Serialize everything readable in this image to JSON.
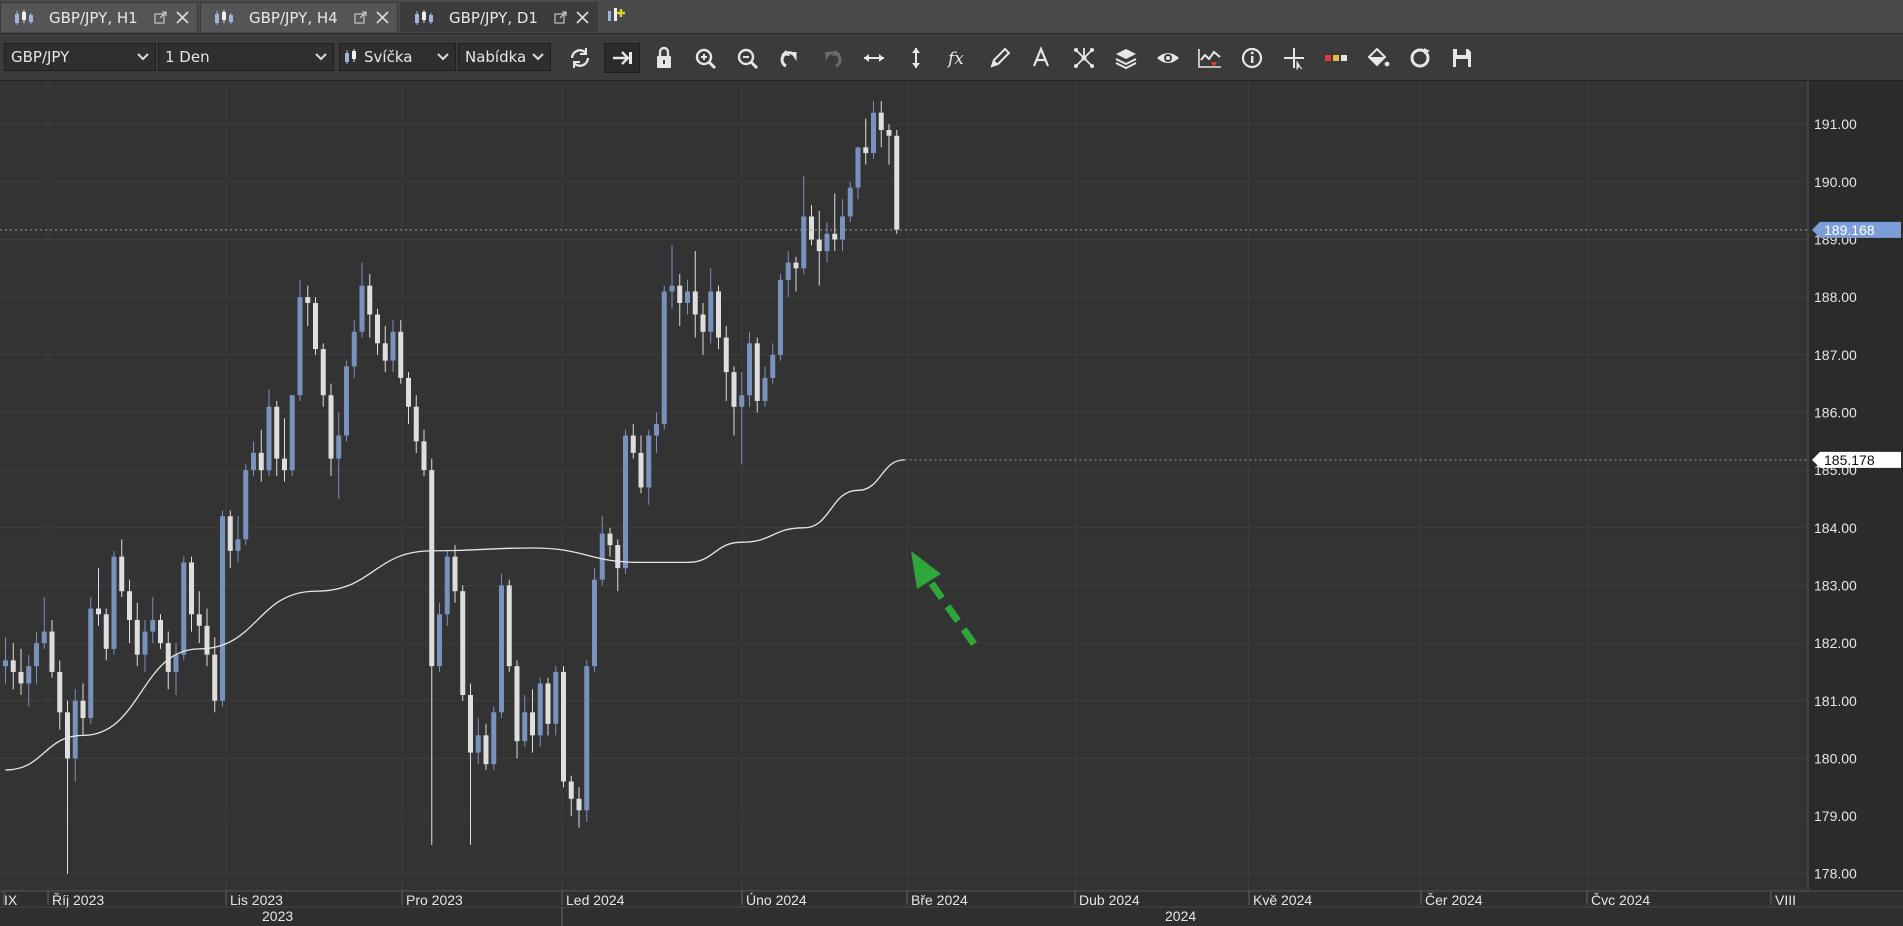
{
  "tabs": [
    {
      "label": "GBP/JPY, H1",
      "active": false
    },
    {
      "label": "GBP/JPY, H4",
      "active": false
    },
    {
      "label": "GBP/JPY, D1",
      "active": true
    }
  ],
  "toolbar": {
    "instrument": "GBP/JPY",
    "period": "1 Den",
    "chart_type": "Svíčka",
    "offer_side": "Nabídka",
    "buttons": [
      "refresh-icon",
      "shift-chart-icon",
      "lock-icon",
      "zoom-in-icon",
      "zoom-out-icon",
      "undo-icon",
      "redo-icon",
      "horizontal-scale-icon",
      "vertical-scale-icon",
      "indicators-fx-icon",
      "pencil-icon",
      "text-icon",
      "pattern-icon",
      "layers-icon",
      "eye-icon",
      "signals-icon",
      "info-icon",
      "crosshair-icon",
      "price-marker-icon",
      "paint-bucket-icon",
      "reload-template-icon",
      "save-icon"
    ],
    "pressed": [
      "shift-chart-icon"
    ]
  },
  "colors": {
    "bull": "#7891bd",
    "bear": "#dedede",
    "ma_line": "#e6e6e6",
    "last_price_badge": "#7c9ed6",
    "ma_badge": "#ffffff",
    "arrow": "#2fa63a",
    "background": "#333333",
    "grid": "#3e3e3e"
  },
  "chart_data": {
    "type": "candlestick",
    "symbol": "GBP/JPY",
    "timeframe": "D1",
    "y_ticks": [
      "191.00",
      "190.00",
      "189.00",
      "188.00",
      "187.00",
      "186.00",
      "185.00",
      "184.00",
      "183.00",
      "182.00",
      "181.00",
      "180.00",
      "179.00",
      "178.00"
    ],
    "ylim": [
      177.7,
      191.75
    ],
    "last_price": "189.168",
    "ma_last": "185.178",
    "x_labels": [
      "IX",
      "Říj 2023",
      "Lis 2023",
      "Pro 2023",
      "Led 2024",
      "Úno 2024",
      "Bře 2024",
      "Dub 2024",
      "Kvě 2024",
      "Čer 2024",
      "Čvc 2024",
      "VIII"
    ],
    "year_labels": [
      "2023",
      "2024"
    ],
    "ohlc": [
      [
        181.6,
        182.1,
        181.3,
        181.7
      ],
      [
        181.7,
        182.0,
        181.2,
        181.5
      ],
      [
        181.5,
        181.9,
        181.1,
        181.3
      ],
      [
        181.3,
        181.8,
        180.9,
        181.6
      ],
      [
        181.6,
        182.2,
        181.3,
        182.0
      ],
      [
        182.0,
        182.8,
        181.9,
        182.2
      ],
      [
        182.2,
        182.4,
        181.4,
        181.5
      ],
      [
        181.5,
        181.7,
        180.5,
        180.8
      ],
      [
        180.8,
        181.0,
        178.0,
        180.0
      ],
      [
        180.0,
        181.2,
        179.6,
        181.0
      ],
      [
        181.0,
        181.3,
        180.4,
        180.7
      ],
      [
        180.7,
        182.8,
        180.6,
        182.6
      ],
      [
        182.6,
        183.3,
        182.3,
        182.5
      ],
      [
        182.5,
        182.6,
        181.7,
        181.9
      ],
      [
        181.9,
        183.6,
        181.8,
        183.5
      ],
      [
        183.5,
        183.8,
        182.8,
        182.9
      ],
      [
        182.9,
        183.1,
        182.0,
        182.4
      ],
      [
        182.4,
        182.7,
        181.6,
        181.8
      ],
      [
        181.8,
        182.4,
        181.5,
        182.2
      ],
      [
        182.2,
        182.8,
        182.0,
        182.4
      ],
      [
        182.4,
        182.5,
        181.9,
        182.0
      ],
      [
        182.0,
        182.2,
        181.2,
        181.5
      ],
      [
        181.5,
        182.0,
        181.1,
        181.8
      ],
      [
        181.8,
        183.5,
        181.7,
        183.4
      ],
      [
        183.4,
        183.5,
        182.2,
        182.5
      ],
      [
        182.5,
        182.9,
        182.0,
        182.3
      ],
      [
        182.3,
        182.6,
        181.6,
        181.8
      ],
      [
        181.8,
        182.1,
        180.8,
        181.0
      ],
      [
        181.0,
        184.3,
        180.9,
        184.2
      ],
      [
        184.2,
        184.3,
        183.3,
        183.6
      ],
      [
        183.6,
        184.2,
        183.4,
        183.8
      ],
      [
        183.8,
        185.1,
        183.7,
        185.0
      ],
      [
        185.0,
        185.5,
        184.9,
        185.3
      ],
      [
        185.3,
        185.7,
        184.8,
        185.0
      ],
      [
        185.0,
        186.4,
        184.9,
        186.1
      ],
      [
        186.1,
        186.2,
        184.9,
        185.2
      ],
      [
        185.2,
        185.9,
        184.8,
        185.0
      ],
      [
        185.0,
        186.3,
        184.9,
        186.3
      ],
      [
        186.3,
        188.3,
        186.2,
        188.0
      ],
      [
        188.0,
        188.2,
        187.5,
        187.9
      ],
      [
        187.9,
        188.0,
        187.0,
        187.1
      ],
      [
        187.1,
        187.2,
        186.1,
        186.3
      ],
      [
        186.3,
        186.5,
        184.9,
        185.2
      ],
      [
        185.2,
        186.0,
        184.5,
        185.6
      ],
      [
        185.6,
        186.9,
        185.5,
        186.8
      ],
      [
        186.8,
        187.6,
        186.6,
        187.4
      ],
      [
        187.4,
        188.6,
        187.3,
        188.2
      ],
      [
        188.2,
        188.4,
        187.3,
        187.7
      ],
      [
        187.7,
        187.8,
        187.0,
        187.2
      ],
      [
        187.2,
        187.5,
        186.7,
        186.9
      ],
      [
        186.9,
        187.6,
        186.7,
        187.4
      ],
      [
        187.4,
        187.6,
        186.5,
        186.6
      ],
      [
        186.6,
        186.7,
        185.8,
        186.1
      ],
      [
        186.1,
        186.3,
        185.3,
        185.5
      ],
      [
        185.5,
        185.7,
        184.9,
        185.0
      ],
      [
        185.0,
        185.2,
        178.5,
        181.6
      ],
      [
        181.6,
        182.7,
        181.5,
        182.5
      ],
      [
        182.5,
        183.6,
        182.3,
        183.5
      ],
      [
        183.5,
        183.7,
        182.7,
        182.9
      ],
      [
        182.9,
        183.0,
        181.0,
        181.1
      ],
      [
        181.1,
        181.3,
        178.5,
        180.1
      ],
      [
        180.1,
        180.7,
        179.9,
        180.4
      ],
      [
        180.4,
        180.6,
        179.8,
        179.9
      ],
      [
        179.9,
        180.9,
        179.8,
        180.8
      ],
      [
        180.8,
        183.2,
        180.7,
        183.0
      ],
      [
        183.0,
        183.1,
        181.5,
        181.6
      ],
      [
        181.6,
        181.7,
        180.0,
        180.3
      ],
      [
        180.3,
        181.1,
        180.2,
        180.8
      ],
      [
        180.8,
        181.2,
        180.1,
        180.4
      ],
      [
        180.4,
        181.4,
        180.2,
        181.3
      ],
      [
        181.3,
        181.4,
        180.4,
        180.6
      ],
      [
        180.6,
        181.6,
        180.4,
        181.5
      ],
      [
        181.5,
        181.6,
        179.5,
        179.6
      ],
      [
        179.6,
        179.7,
        179.0,
        179.3
      ],
      [
        179.3,
        179.5,
        178.8,
        179.1
      ],
      [
        179.1,
        181.7,
        178.9,
        181.6
      ],
      [
        181.6,
        183.3,
        181.5,
        183.1
      ],
      [
        183.1,
        184.2,
        183.0,
        183.9
      ],
      [
        183.9,
        184.0,
        183.5,
        183.7
      ],
      [
        183.7,
        183.8,
        182.9,
        183.3
      ],
      [
        183.3,
        185.7,
        183.2,
        185.6
      ],
      [
        185.6,
        185.8,
        185.2,
        185.3
      ],
      [
        185.3,
        185.6,
        184.6,
        184.7
      ],
      [
        184.7,
        185.7,
        184.4,
        185.6
      ],
      [
        185.6,
        186.0,
        185.3,
        185.8
      ],
      [
        185.8,
        188.2,
        185.7,
        188.1
      ],
      [
        188.1,
        188.9,
        187.8,
        188.2
      ],
      [
        188.2,
        188.4,
        187.5,
        187.9
      ],
      [
        187.9,
        188.3,
        187.7,
        188.1
      ],
      [
        188.1,
        188.8,
        187.3,
        187.7
      ],
      [
        187.7,
        187.9,
        187.0,
        187.4
      ],
      [
        187.4,
        188.5,
        187.2,
        188.1
      ],
      [
        188.1,
        188.2,
        187.1,
        187.3
      ],
      [
        187.3,
        187.5,
        186.2,
        186.7
      ],
      [
        186.7,
        186.8,
        185.6,
        186.1
      ],
      [
        186.1,
        186.7,
        185.1,
        186.3
      ],
      [
        186.3,
        187.4,
        186.1,
        187.2
      ],
      [
        187.2,
        187.3,
        186.0,
        186.2
      ],
      [
        186.2,
        186.8,
        186.1,
        186.6
      ],
      [
        186.6,
        187.2,
        186.5,
        187.0
      ],
      [
        187.0,
        188.4,
        186.9,
        188.3
      ],
      [
        188.3,
        188.8,
        188.0,
        188.6
      ],
      [
        188.6,
        188.7,
        188.1,
        188.5
      ],
      [
        188.5,
        190.1,
        188.4,
        189.4
      ],
      [
        189.4,
        189.6,
        188.9,
        189.0
      ],
      [
        189.0,
        189.5,
        188.2,
        188.8
      ],
      [
        188.8,
        189.3,
        188.6,
        189.1
      ],
      [
        189.1,
        189.8,
        188.8,
        189.0
      ],
      [
        189.0,
        189.7,
        188.8,
        189.4
      ],
      [
        189.4,
        190.0,
        189.3,
        189.9
      ],
      [
        189.9,
        190.6,
        189.7,
        190.6
      ],
      [
        190.6,
        191.1,
        190.3,
        190.5
      ],
      [
        190.5,
        191.4,
        190.4,
        191.2
      ],
      [
        191.2,
        191.4,
        190.6,
        190.9
      ],
      [
        190.9,
        191.0,
        190.3,
        190.8
      ],
      [
        190.8,
        190.9,
        189.1,
        189.17
      ]
    ],
    "ma_points": [
      [
        0,
        179.8
      ],
      [
        10,
        180.4
      ],
      [
        25,
        181.9
      ],
      [
        40,
        182.9
      ],
      [
        55,
        183.6
      ],
      [
        68,
        183.65
      ],
      [
        82,
        183.4
      ],
      [
        88,
        183.4
      ],
      [
        95,
        183.75
      ],
      [
        103,
        184.0
      ],
      [
        110,
        184.65
      ],
      [
        116,
        185.178
      ]
    ]
  }
}
